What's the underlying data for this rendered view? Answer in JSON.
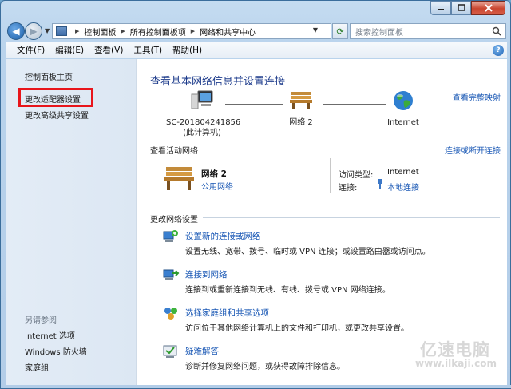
{
  "address": {
    "crumbs": [
      "控制面板",
      "所有控制面板项",
      "网络和共享中心"
    ],
    "search_placeholder": "搜索控制面板"
  },
  "menubar": {
    "items": [
      "文件(F)",
      "编辑(E)",
      "查看(V)",
      "工具(T)",
      "帮助(H)"
    ]
  },
  "sidebar": {
    "home": "控制面板主页",
    "adapter": "更改适配器设置",
    "advanced": "更改高级共享设置",
    "see_also": "另请参阅",
    "links": [
      "Internet 选项",
      "Windows 防火墙",
      "家庭组"
    ]
  },
  "main": {
    "title": "查看基本网络信息并设置连接",
    "full_map": "查看完整映射",
    "nodes": {
      "computer_name": "SC-201804241856",
      "computer_sub": "(此计算机)",
      "network": "网络  2",
      "internet": "Internet"
    },
    "active": {
      "heading": "查看活动网络",
      "connect_link": "连接或断开连接",
      "network_name": "网络  2",
      "network_type": "公用网络",
      "access_label": "访问类型:",
      "access_value": "Internet",
      "conn_label": "连接:",
      "conn_value": "本地连接"
    },
    "change": {
      "heading": "更改网络设置",
      "tasks": [
        {
          "title": "设置新的连接或网络",
          "desc": "设置无线、宽带、拨号、临时或 VPN 连接；或设置路由器或访问点。"
        },
        {
          "title": "连接到网络",
          "desc": "连接到或重新连接到无线、有线、拨号或 VPN 网络连接。"
        },
        {
          "title": "选择家庭组和共享选项",
          "desc": "访问位于其他网络计算机上的文件和打印机，或更改共享设置。"
        },
        {
          "title": "疑难解答",
          "desc": "诊断并修复网络问题，或获得故障排除信息。"
        }
      ]
    }
  },
  "watermark": {
    "text": "亿速电脑",
    "sub": "www.ilkaji.com"
  },
  "colors": {
    "link": "#1a58b5",
    "title": "#1e3c8c",
    "highlight": "#e8151b"
  }
}
